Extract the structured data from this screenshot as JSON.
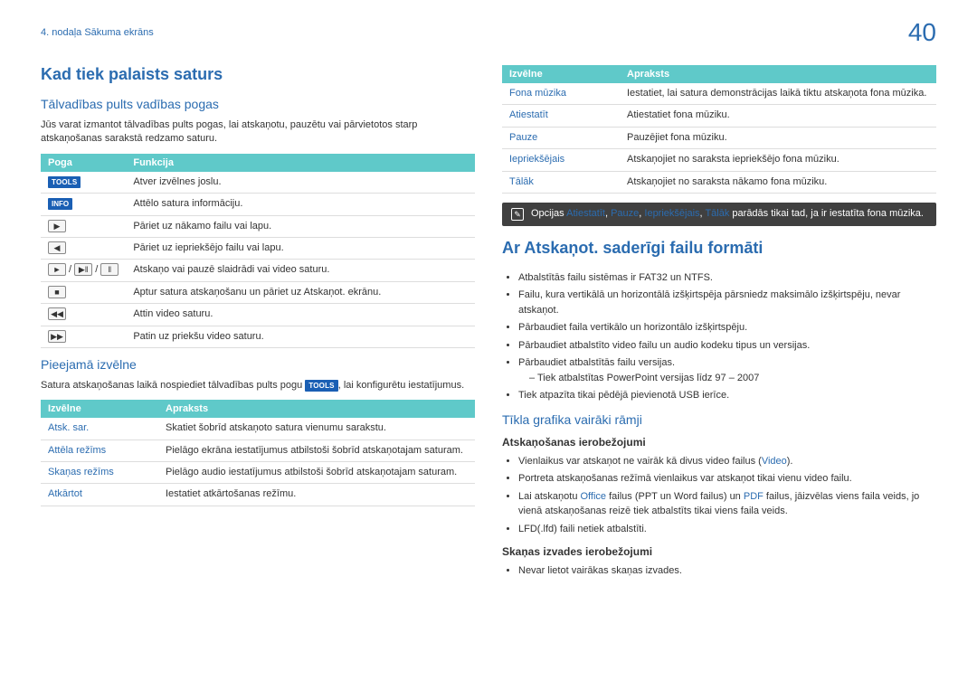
{
  "page_number": "40",
  "breadcrumb": "4. nodaļa Sākuma ekrāns",
  "left": {
    "title": "Kad tiek palaists saturs",
    "sec1": {
      "heading": "Tālvadības pults vadības pogas",
      "para": "Jūs varat izmantot tālvadības pults pogas, lai atskaņotu, pauzētu vai pārvietotos starp atskaņošanas sarakstā redzamo saturu.",
      "th1": "Poga",
      "th2": "Funkcija",
      "rows": [
        {
          "icon_type": "tools",
          "desc": "Atver izvēlnes joslu."
        },
        {
          "icon_type": "info",
          "desc": "Attēlo satura informāciju."
        },
        {
          "icon_type": "next",
          "desc": "Pāriet uz nākamo failu vai lapu."
        },
        {
          "icon_type": "prev",
          "desc": "Pāriet uz iepriekšējo failu vai lapu."
        },
        {
          "icon_type": "play_pause",
          "desc": "Atskaņo vai pauzē slaidrādi vai video saturu."
        },
        {
          "icon_type": "stop",
          "desc": "Aptur satura atskaņošanu un pāriet uz Atskaņot. ekrānu."
        },
        {
          "icon_type": "rewind",
          "desc": "Attin video saturu."
        },
        {
          "icon_type": "forward",
          "desc": "Patin uz priekšu video saturu."
        }
      ]
    },
    "sec2": {
      "heading": "Pieejamā izvēlne",
      "para_pre": "Satura atskaņošanas laikā nospiediet tālvadības pults pogu ",
      "para_post": ", lai konfigurētu iestatījumus.",
      "th1": "Izvēlne",
      "th2": "Apraksts",
      "rows": [
        {
          "name": "Atsk. sar.",
          "desc": "Skatiet šobrīd atskaņoto satura vienumu sarakstu."
        },
        {
          "name": "Attēla režīms",
          "desc": "Pielāgo ekrāna iestatījumus atbilstoši šobrīd atskaņotajam saturam."
        },
        {
          "name": "Skaņas režīms",
          "desc": "Pielāgo audio iestatījumus atbilstoši šobrīd atskaņotajam saturam."
        },
        {
          "name": "Atkārtot",
          "desc": "Iestatiet atkārtošanas režīmu."
        }
      ]
    }
  },
  "right": {
    "table": {
      "th1": "Izvēlne",
      "th2": "Apraksts",
      "rows": [
        {
          "name": "Fona mūzika",
          "desc": "Iestatiet, lai satura demonstrācijas laikā tiktu atskaņota fona mūzika."
        },
        {
          "name": "Atiestatīt",
          "desc": "Atiestatiet fona mūziku."
        },
        {
          "name": "Pauze",
          "desc": "Pauzējiet fona mūziku."
        },
        {
          "name": "Iepriekšējais",
          "desc": "Atskaņojiet no saraksta iepriekšējo fona mūziku."
        },
        {
          "name": "Tālāk",
          "desc": "Atskaņojiet no saraksta nākamo fona mūziku."
        }
      ]
    },
    "note": {
      "pre": "Opcijas ",
      "o1": "Atiestatīt",
      "o2": "Pauze",
      "o3": "Iepriekšējais",
      "o4": "Tālāk",
      "post": " parādās tikai tad, ja ir iestatīta fona mūzika."
    },
    "title2": "Ar Atskaņot. saderīgi failu formāti",
    "bullets1": [
      "Atbalstītās failu sistēmas ir FAT32 un NTFS.",
      "Failu, kura vertikālā un horizontālā izšķirtspēja pārsniedz maksimālo izšķirtspēju, nevar atskaņot.",
      "Pārbaudiet faila vertikālo un horizontālo izšķirtspēju.",
      "Pārbaudiet atbalstīto video failu un audio kodeku tipus un versijas.",
      "Pārbaudiet atbalstītās failu versijas."
    ],
    "sub_bullet": "Tiek atbalstītas PowerPoint versijas līdz 97 – 2007",
    "bullet_last": "Tiek atpazīta tikai pēdējā pievienotā USB ierīce.",
    "sec3": {
      "heading": "Tīkla grafika vairāki rāmji",
      "sub1": "Atskaņošanas ierobežojumi",
      "b1_pre": "Vienlaikus var atskaņot ne vairāk kā divus video failus (",
      "b1_blue": "Video",
      "b1_post": ").",
      "b2": "Portreta atskaņošanas režīmā vienlaikus var atskaņot tikai vienu video failu.",
      "b3_pre": "Lai atskaņotu ",
      "b3_blue1": "Office",
      "b3_mid": " failus (PPT un Word failus) un ",
      "b3_blue2": "PDF",
      "b3_post": " failus, jāizvēlas viens faila veids, jo vienā atskaņošanas reizē tiek atbalstīts tikai viens faila veids.",
      "b4": "LFD(.lfd) faili netiek atbalstīti.",
      "sub2": "Skaņas izvades ierobežojumi",
      "b5": "Nevar lietot vairākas skaņas izvades."
    }
  },
  "labels": {
    "tools": "TOOLS",
    "info": "INFO"
  }
}
